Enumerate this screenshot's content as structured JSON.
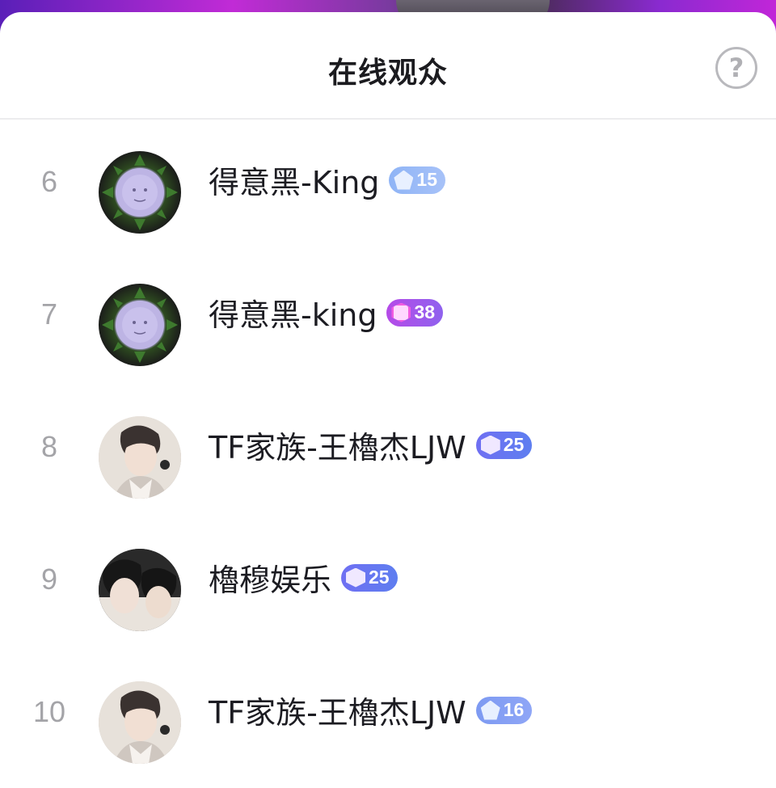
{
  "header": {
    "title": "在线观众",
    "help_icon": "?"
  },
  "viewers": [
    {
      "rank": "6",
      "name": "得意黑-King",
      "level": "15",
      "badge_color": "#9db9f6",
      "avatar": "buddha-avatar"
    },
    {
      "rank": "7",
      "name": "得意黑-king",
      "level": "38",
      "badge_color": "#a957ea",
      "avatar": "buddha-avatar"
    },
    {
      "rank": "8",
      "name": "TF家族-王櫓杰LJW",
      "level": "25",
      "badge_color": "#6a74f1",
      "avatar": "photo-avatar"
    },
    {
      "rank": "9",
      "name": "櫓穆娱乐",
      "level": "25",
      "badge_color": "#6a74f1",
      "avatar": "photo-avatar"
    },
    {
      "rank": "10",
      "name": "TF家族-王櫓杰LJW",
      "level": "16",
      "badge_color": "#6a74f1",
      "avatar": "photo-avatar"
    }
  ]
}
